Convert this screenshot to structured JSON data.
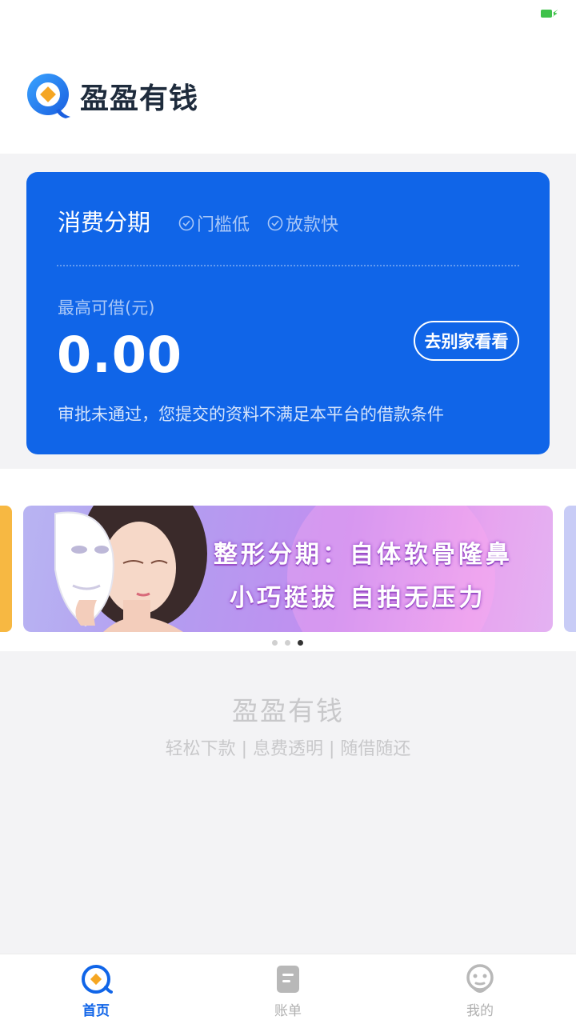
{
  "app": {
    "name": "盈盈有钱"
  },
  "card": {
    "title": "消费分期",
    "tags": [
      "门槛低",
      "放款快"
    ],
    "limit_label": "最高可借(元)",
    "amount": "0.00",
    "other_button": "去别家看看",
    "notice": "审批未通过，您提交的资料不满足本平台的借款条件"
  },
  "banner": {
    "line1": "整形分期：自体软骨隆鼻",
    "line2": "小巧挺拔 自拍无压力",
    "slide_count": 3,
    "active_slide": 3
  },
  "slogan": {
    "title": "盈盈有钱",
    "subtitle": "轻松下款 | 息费透明 | 随借随还"
  },
  "tabbar": {
    "items": [
      {
        "label": "首页",
        "icon": "home-icon",
        "active": true
      },
      {
        "label": "账单",
        "icon": "bill-icon",
        "active": false
      },
      {
        "label": "我的",
        "icon": "profile-icon",
        "active": false
      }
    ]
  },
  "colors": {
    "primary": "#1065e8",
    "background": "#f3f3f5",
    "battery": "#3ec24a"
  }
}
